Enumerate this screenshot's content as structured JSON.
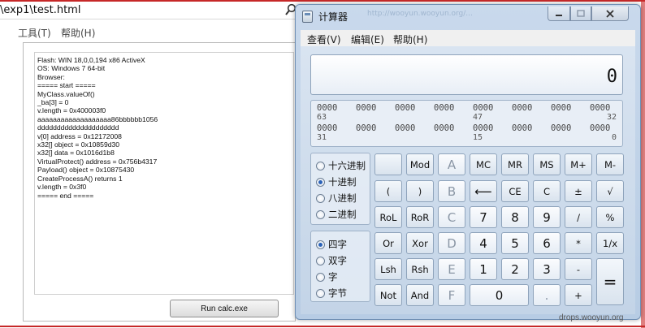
{
  "browser": {
    "address": "\\exp1\\test.html",
    "menu": [
      "工具(T)",
      "帮助(H)"
    ],
    "output_lines": [
      "Flash: WIN 18,0,0,194 x86 ActiveX",
      "OS: Windows 7 64-bit",
      "Browser:",
      "===== start =====",
      "MyClass.valueOf()",
      "_ba[3] = 0",
      "v.length = 0x400003f0",
      "aaaaaaaaaaaaaaaaaaa86bbbbbb1056",
      "ddddddddddddddddddddd",
      "v[0] address = 0x12172008",
      "x32[] object = 0x10859d30",
      "x32[] data = 0x1016d1b8",
      "VirtualProtect() address = 0x756b4317",
      "Payload() object = 0x10875430",
      "CreateProcessA() returns 1",
      "v.length = 0x3f0",
      "===== end ====="
    ],
    "run_button": "Run calc.exe"
  },
  "calc": {
    "title": "计算器",
    "ghost_url": "http://wooyun.wooyun.org/...",
    "menu": [
      "查看(V)",
      "编辑(E)",
      "帮助(H)"
    ],
    "display": "0",
    "bits": {
      "row1": [
        "0000",
        "0000",
        "0000",
        "0000",
        "0000",
        "0000",
        "0000",
        "0000"
      ],
      "row1_pos": [
        "63",
        "47",
        "32"
      ],
      "row2": [
        "0000",
        "0000",
        "0000",
        "0000",
        "0000",
        "0000",
        "0000",
        "0000"
      ],
      "row2_pos": [
        "31",
        "15",
        "0"
      ]
    },
    "radix": [
      "十六进制",
      "十进制",
      "八进制",
      "二进制"
    ],
    "radix_selected": "十进制",
    "word": [
      "四字",
      "双字",
      "字",
      "字节"
    ],
    "word_selected": "四字",
    "keys": {
      "r1": [
        "",
        "Mod",
        "A",
        "MC",
        "MR",
        "MS",
        "M+",
        "M-"
      ],
      "r2": [
        "(",
        ")",
        "B",
        "⟵",
        "CE",
        "C",
        "±",
        "√"
      ],
      "r3": [
        "RoL",
        "RoR",
        "C",
        "7",
        "8",
        "9",
        "/",
        "%"
      ],
      "r4": [
        "Or",
        "Xor",
        "D",
        "4",
        "5",
        "6",
        "*",
        "1/x"
      ],
      "r5": [
        "Lsh",
        "Rsh",
        "E",
        "1",
        "2",
        "3",
        "-",
        "="
      ],
      "r6": [
        "Not",
        "And",
        "F",
        "0",
        ".",
        "+"
      ]
    }
  },
  "watermark": "drops.wooyun.org"
}
